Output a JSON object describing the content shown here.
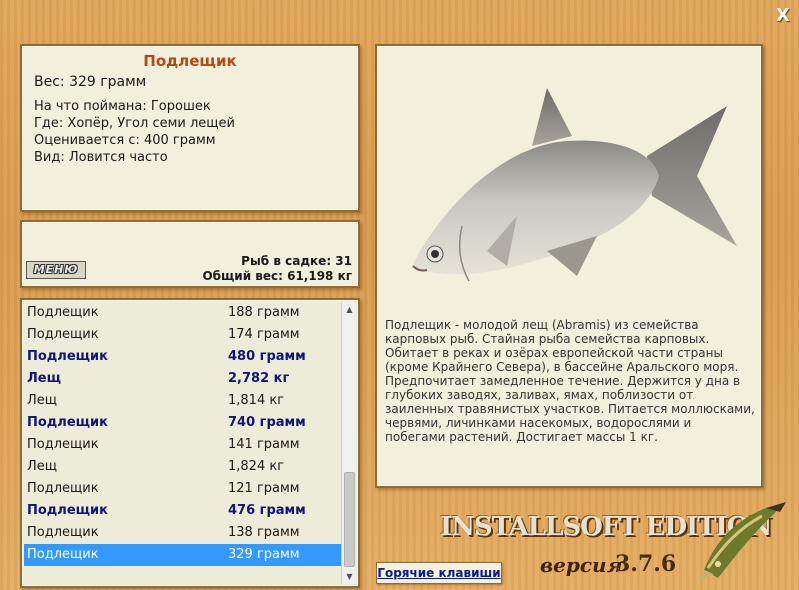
{
  "window": {
    "close_label": "X"
  },
  "fish": {
    "name": "Подлещик",
    "weight": "Вес: 329 грамм",
    "lines": [
      "На что поймана: Горошек",
      "Где: Хопёр, Угол семи лещей",
      "Оценивается с: 400 грамм",
      "Вид: Ловится часто"
    ]
  },
  "summary": {
    "menu_label": "МЕНЮ",
    "count": "Рыб в садке: 31",
    "total": "Общий вес: 61,198 кг"
  },
  "catch_list": [
    {
      "name": "Подлещик",
      "weight": "188 грамм",
      "bold": false
    },
    {
      "name": "Подлещик",
      "weight": "174 грамм",
      "bold": false
    },
    {
      "name": "Подлещик",
      "weight": "480 грамм",
      "bold": true
    },
    {
      "name": "Лещ",
      "weight": "2,782 кг",
      "bold": true
    },
    {
      "name": "Лещ",
      "weight": "1,814 кг",
      "bold": false
    },
    {
      "name": "Подлещик",
      "weight": "740 грамм",
      "bold": true
    },
    {
      "name": "Подлещик",
      "weight": "141 грамм",
      "bold": false
    },
    {
      "name": "Лещ",
      "weight": "1,824 кг",
      "bold": false
    },
    {
      "name": "Подлещик",
      "weight": "121 грамм",
      "bold": false
    },
    {
      "name": "Подлещик",
      "weight": "476 грамм",
      "bold": true
    },
    {
      "name": "Подлещик",
      "weight": "138 грамм",
      "bold": false
    },
    {
      "name": "Подлещик",
      "weight": "329 грамм",
      "bold": false,
      "selected": true
    }
  ],
  "description": "Подлещик - молодой лещ (Abramis) из семейства карповых рыб. Стайная рыба семейства карповых. Обитает в реках и озёрах европейской части страны (кроме Крайнего Севера), в бассейне Аральского моря. Предпочитает замедленное течение. Держится у дна в глубоких заводях, заливах, ямах, поблизости от заиленных травянистых участков. Питается моллюсками, червями, личинками насекомых, водорослями и побегами растений. Достигает массы 1 кг.",
  "footer": {
    "hotkeys": "Горячие клавиши",
    "edition": "INSTALLSOFT EDITION",
    "version_label": "версия",
    "version": "3.7.6"
  },
  "colors": {
    "title": "#b44a12",
    "bold_row": "#13137a",
    "selection": "#3399ff",
    "background": "#d89a4d"
  },
  "icons": [
    "close-icon",
    "scroll-up-icon",
    "scroll-down-icon",
    "fish-picture",
    "pike-logo"
  ]
}
